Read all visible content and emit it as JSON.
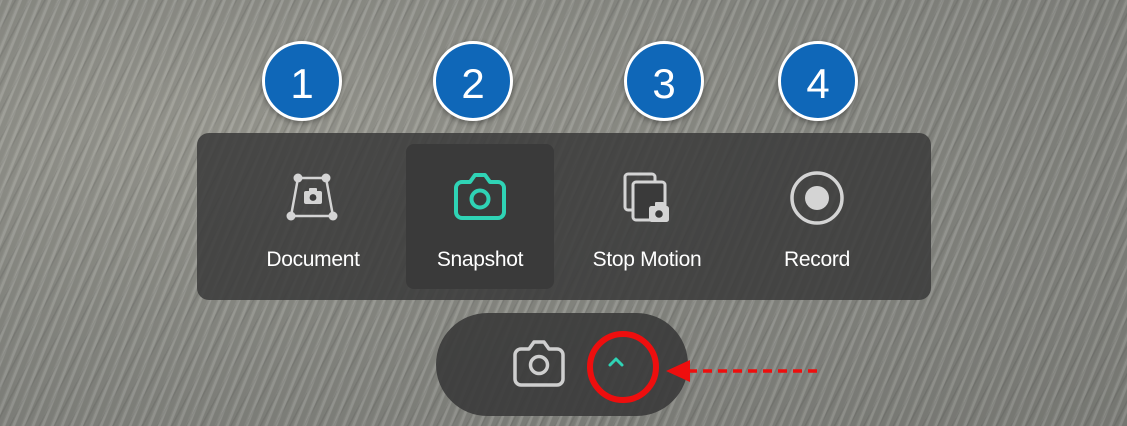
{
  "badges": [
    "1",
    "2",
    "3",
    "4"
  ],
  "modes": [
    {
      "label": "Document",
      "icon": "document-scan-icon",
      "selected": false
    },
    {
      "label": "Snapshot",
      "icon": "camera-icon",
      "selected": true
    },
    {
      "label": "Stop Motion",
      "icon": "stop-motion-icon",
      "selected": false
    },
    {
      "label": "Record",
      "icon": "record-icon",
      "selected": false
    }
  ],
  "bottom_bar": {
    "capture_icon": "camera-icon",
    "expand_icon": "chevron-up-icon"
  },
  "colors": {
    "badge": "#0f67b8",
    "accent": "#2fd3b5",
    "icon_gray": "#d4d4d4",
    "panel": "#3a3a3a",
    "highlight_ring": "#ee0e0e"
  }
}
